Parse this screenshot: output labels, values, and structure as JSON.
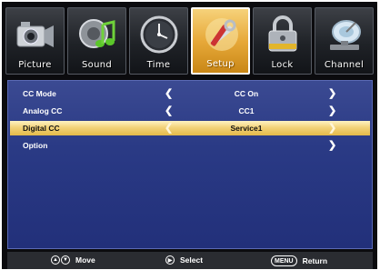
{
  "tabs": [
    {
      "label": "Picture",
      "icon": "camera-icon",
      "active": false
    },
    {
      "label": "Sound",
      "icon": "speaker-note-icon",
      "active": false
    },
    {
      "label": "Time",
      "icon": "clock-icon",
      "active": false
    },
    {
      "label": "Setup",
      "icon": "tools-icon",
      "active": true
    },
    {
      "label": "Lock",
      "icon": "padlock-icon",
      "active": false
    },
    {
      "label": "Channel",
      "icon": "satellite-dish-icon",
      "active": false
    }
  ],
  "menu": {
    "rows": [
      {
        "name": "CC Mode",
        "value": "CC On",
        "has_left": true,
        "has_right": true,
        "selected": false
      },
      {
        "name": "Analog CC",
        "value": "CC1",
        "has_left": true,
        "has_right": true,
        "selected": false
      },
      {
        "name": "Digital CC",
        "value": "Service1",
        "has_left": true,
        "has_right": true,
        "selected": true
      },
      {
        "name": "Option",
        "value": "",
        "has_left": false,
        "has_right": true,
        "selected": false
      }
    ]
  },
  "footer": {
    "move_label": "Move",
    "select_label": "Select",
    "menu_key": "MENU",
    "return_label": "Return"
  },
  "colors": {
    "panel": "#2a3a85",
    "highlight": "#f2d37a",
    "active_tab": "#e7a93a"
  }
}
